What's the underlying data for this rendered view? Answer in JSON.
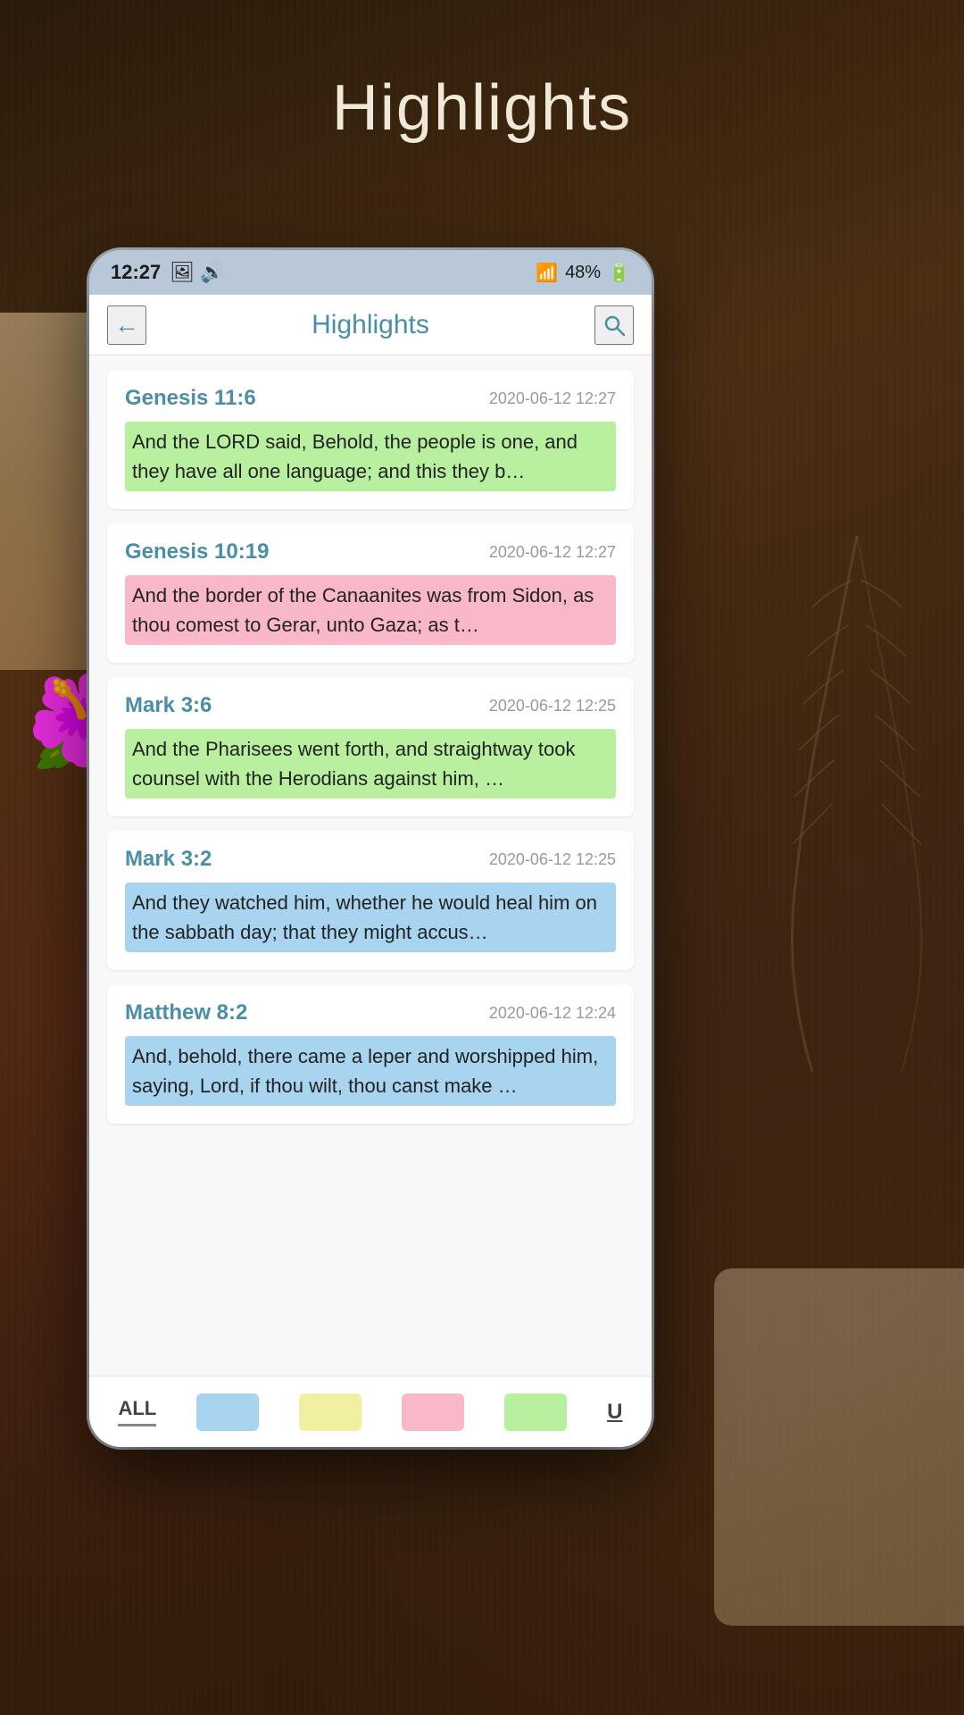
{
  "page": {
    "background_title": "Highlights"
  },
  "status_bar": {
    "time": "12:27",
    "battery": "48%",
    "signal": "▲▲▲",
    "icons": "🖼 🔊"
  },
  "header": {
    "title": "Highlights",
    "back_label": "←",
    "search_label": "🔍"
  },
  "highlights": [
    {
      "reference": "Genesis 11:6",
      "date": "2020-06-12 12:27",
      "text": "And the LORD said, Behold, the people is one, and they have all one language; and this they b…",
      "highlight_color": "green"
    },
    {
      "reference": "Genesis 10:19",
      "date": "2020-06-12 12:27",
      "text": "And the border of the Canaanites was from Sidon, as thou comest to Gerar, unto Gaza; as t…",
      "highlight_color": "pink"
    },
    {
      "reference": "Mark 3:6",
      "date": "2020-06-12 12:25",
      "text": "And the Pharisees went forth, and straightway took counsel with the Herodians against him, …",
      "highlight_color": "green"
    },
    {
      "reference": "Mark 3:2",
      "date": "2020-06-12 12:25",
      "text": "And they watched him, whether he would heal him on the sabbath day; that they might accus…",
      "highlight_color": "blue"
    },
    {
      "reference": "Matthew 8:2",
      "date": "2020-06-12 12:24",
      "text": "And, behold, there came a leper and worshipped him, saying, Lord, if thou wilt, thou canst make …",
      "highlight_color": "blue"
    }
  ],
  "bottom_tabs": {
    "all_label": "ALL",
    "underline_label": "U",
    "colors": [
      "blue",
      "yellow",
      "pink",
      "green"
    ]
  }
}
